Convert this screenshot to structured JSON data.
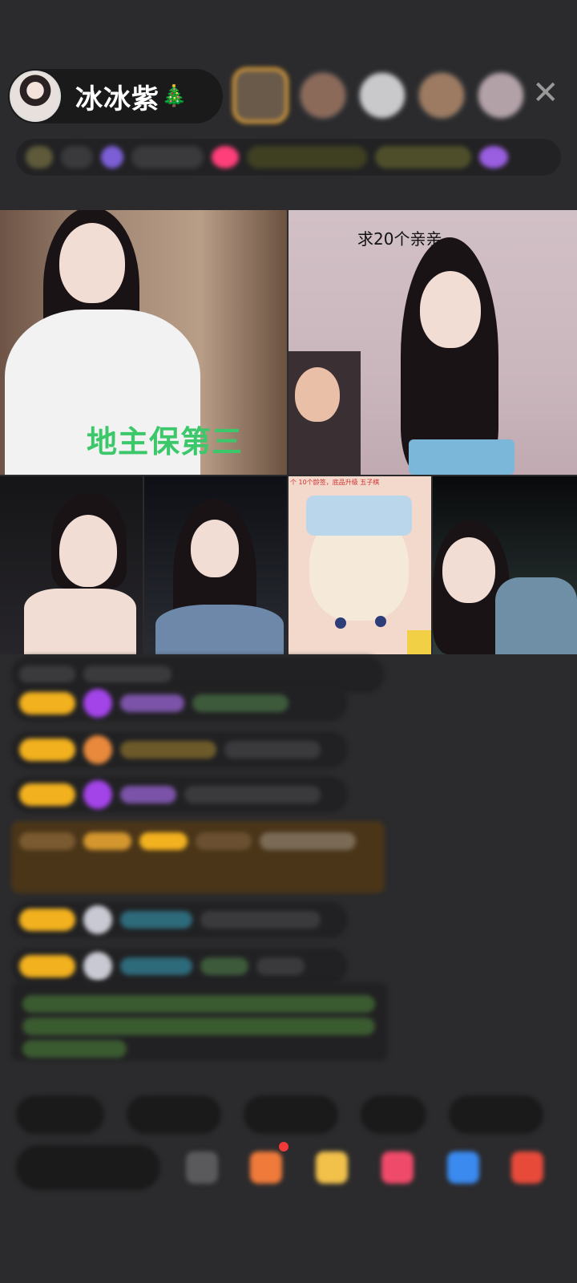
{
  "host": {
    "name": "冰冰紫",
    "badge": "🎄"
  },
  "close_label": "✕",
  "info_bar": {
    "chips": [
      "",
      "",
      "",
      "",
      "",
      "",
      "",
      ""
    ]
  },
  "video_grid": {
    "tile1_overlay": "地主保第三",
    "tile2_overlay": "求20个亲亲",
    "tile5_corner": "个  10个龄签，底品升级  五子棋"
  },
  "chat": {
    "messages": [
      {
        "text": ""
      },
      {
        "text": ""
      },
      {
        "text": ""
      },
      {
        "text": ""
      },
      {
        "text": ""
      },
      {
        "text": ""
      }
    ]
  },
  "chips": [
    "",
    "",
    "",
    "",
    ""
  ],
  "input": {
    "placeholder": ""
  }
}
